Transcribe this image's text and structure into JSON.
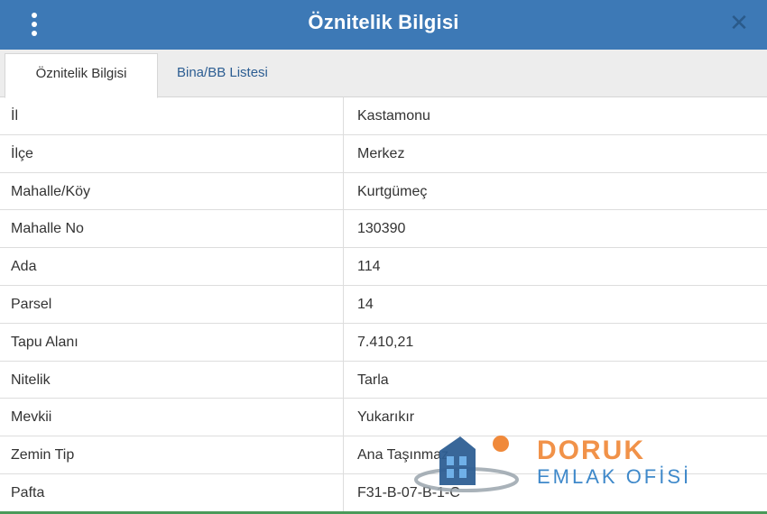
{
  "header": {
    "title": "Öznitelik Bilgisi",
    "close_symbol": "✕"
  },
  "tabs": [
    {
      "label": "Öznitelik Bilgisi",
      "active": true
    },
    {
      "label": "Bina/BB Listesi",
      "active": false
    }
  ],
  "attributes": [
    {
      "key": "İl",
      "value": "Kastamonu"
    },
    {
      "key": "İlçe",
      "value": "Merkez"
    },
    {
      "key": "Mahalle/Köy",
      "value": "Kurtgümeç"
    },
    {
      "key": "Mahalle No",
      "value": "130390"
    },
    {
      "key": "Ada",
      "value": "114"
    },
    {
      "key": "Parsel",
      "value": "14"
    },
    {
      "key": "Tapu Alanı",
      "value": "7.410,21"
    },
    {
      "key": "Nitelik",
      "value": "Tarla"
    },
    {
      "key": "Mevkii",
      "value": "Yukarıkır"
    },
    {
      "key": "Zemin Tip",
      "value": "Ana Taşınmaz"
    },
    {
      "key": "Pafta",
      "value": "F31-B-07-B-1-C"
    }
  ],
  "watermark": {
    "line1": "DORUK",
    "line2": "EMLAK OFİSİ"
  },
  "colors": {
    "titlebar": "#3d79b6",
    "tab_link": "#2c5d92",
    "watermark_orange": "#f0893a",
    "watermark_blue": "#2f7fc6"
  },
  "icons": {
    "menu": "vertical-dots-icon",
    "close": "close-icon",
    "logo": "house-logo-icon"
  }
}
